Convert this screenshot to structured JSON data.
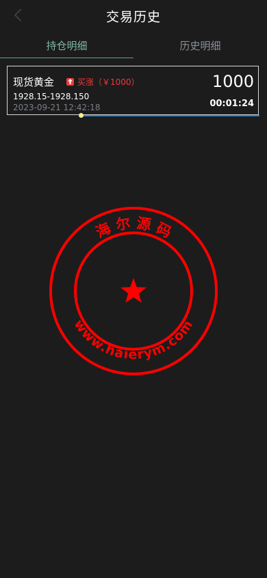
{
  "header": {
    "title": "交易历史",
    "back_icon": "chevron-left-icon"
  },
  "tabs": [
    {
      "label": "持仓明细",
      "active": true
    },
    {
      "label": "历史明细",
      "active": false
    }
  ],
  "position": {
    "product_name": "现货黄金",
    "direction_label": "买涨（￥1000）",
    "direction_icon": "up-arrow-icon",
    "price_range": "1928.15-1928.150",
    "open_time": "2023-09-21 12:42:18",
    "amount": "1000",
    "countdown": "00:01:24"
  },
  "watermark": {
    "top_text": "海 尔 源 码",
    "bottom_text": "www.haierym.com",
    "star_icon": "star-icon"
  },
  "colors": {
    "background": "#1c1c1c",
    "tab_active": "#7fb9a2",
    "tab_inactive": "#8a8f99",
    "rise_red": "#ee3b3b",
    "progress_blue": "#1e7fd6",
    "seal_red": "#ff0000"
  }
}
